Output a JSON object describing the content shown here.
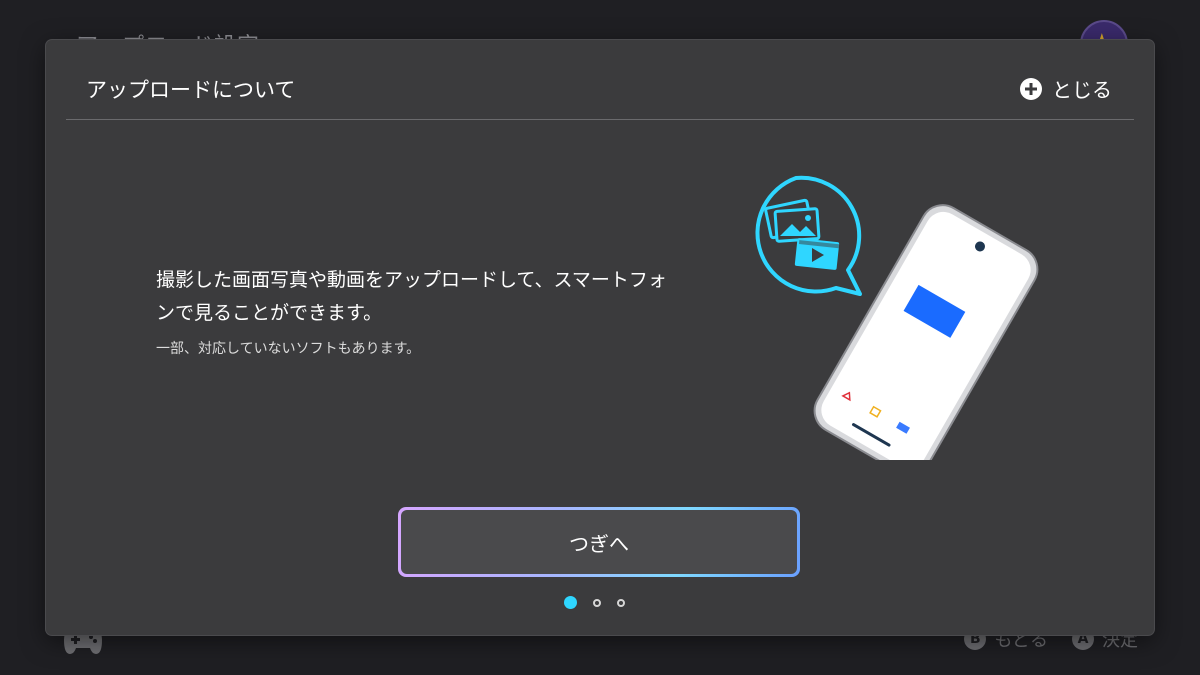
{
  "background": {
    "title": "アップロード設定",
    "hints": [
      {
        "glyph": "B",
        "label": "もどる"
      },
      {
        "glyph": "A",
        "label": "決定"
      }
    ]
  },
  "dialog": {
    "title": "アップロードについて",
    "close_label": "とじる",
    "main_text": "撮影した画面写真や動画をアップロードして、スマートフォンで見ることができます。",
    "sub_text": "一部、対応していないソフトもあります。",
    "next_label": "つぎへ",
    "pager": {
      "total": 3,
      "current": 1
    }
  },
  "colors": {
    "accent": "#2fd6ff",
    "dialog_bg": "#3b3b3d",
    "phone_highlight": "#1a6bff"
  }
}
